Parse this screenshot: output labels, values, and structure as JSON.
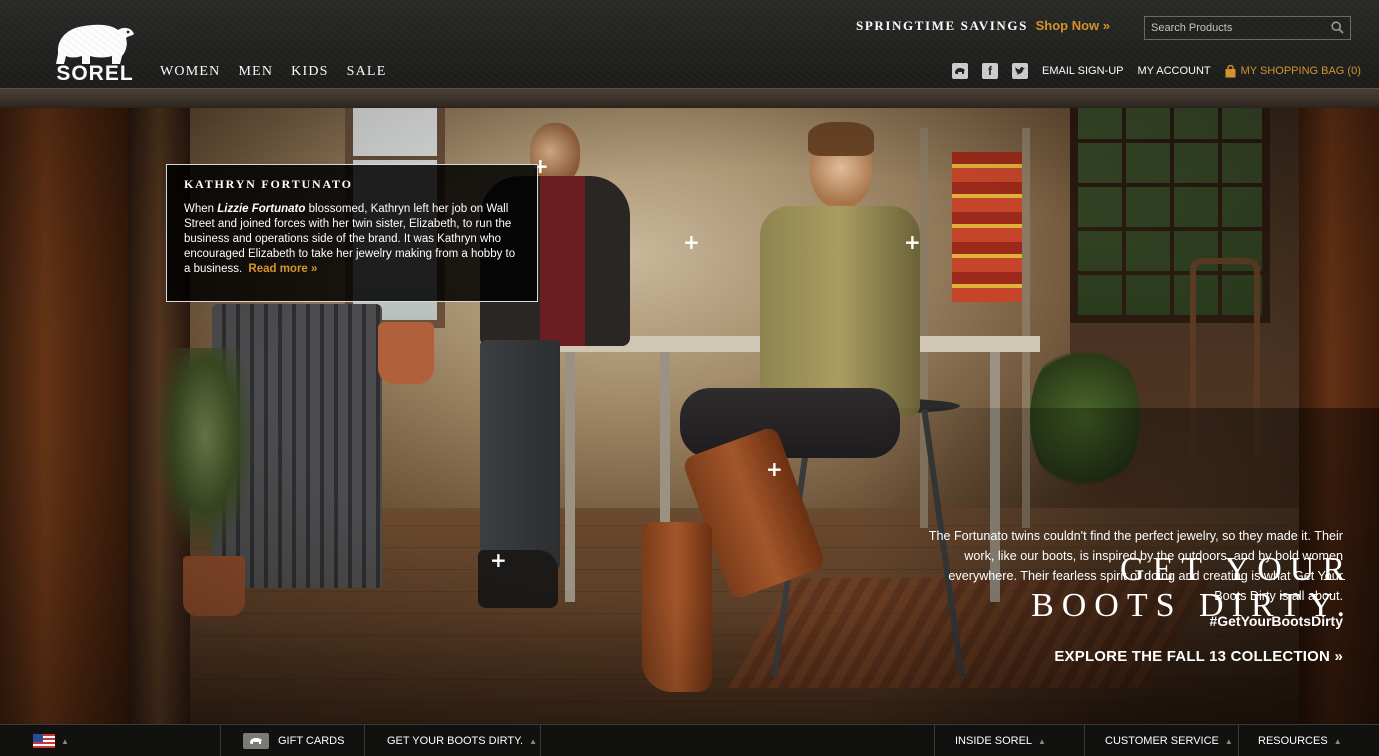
{
  "header": {
    "logo_text": "SOREL",
    "nav": [
      "WOMEN",
      "MEN",
      "KIDS",
      "SALE"
    ],
    "promo_label": "SPRINGTIME SAVINGS",
    "promo_link": "Shop Now »",
    "search_placeholder": "Search Products",
    "social_icons": [
      "sorel-icon",
      "facebook-icon",
      "twitter-icon"
    ],
    "email_signup": "EMAIL SIGN-UP",
    "my_account": "MY ACCOUNT",
    "shopping_bag": "MY SHOPPING BAG (0)"
  },
  "story": {
    "title": "KATHRYN FORTUNATO",
    "body_pre": "When ",
    "body_em": "Lizzie Fortunato",
    "body_post": " blossomed, Kathryn left her job on Wall Street and joined forces with her twin sister, Elizabeth, to run the business and operations side of the brand. It was Kathryn who encouraged Elizabeth to take her jewelry making from a hobby to a business.",
    "read_more": "Read more »"
  },
  "hero": {
    "headline_line1": "GET YOUR",
    "headline_line2": "BOOTS DIRTY.",
    "copy": "The Fortunato twins couldn't find the perfect jewelry, so they made it. Their work, like our boots, is inspired by the outdoors, and by bold women everywhere. Their fearless spirit of doing and creating is what Get Your Boots Dirty is all about.",
    "hashtag": "#GetYourBootsDirty",
    "cta": "EXPLORE THE FALL 13 COLLECTION »",
    "hotspot_glyph": "+"
  },
  "footer": {
    "country_icon": "us-flag-icon",
    "gift_cards": "GIFT CARDS",
    "get_dirty": "GET YOUR BOOTS DIRTY.",
    "inside_sorel": "INSIDE SOREL",
    "customer_service": "CUSTOMER SERVICE",
    "resources": "RESOURCES",
    "caret": "▲"
  },
  "colors": {
    "accent": "#d7942b",
    "header_bg": "#222220",
    "footer_bg": "#111110"
  }
}
